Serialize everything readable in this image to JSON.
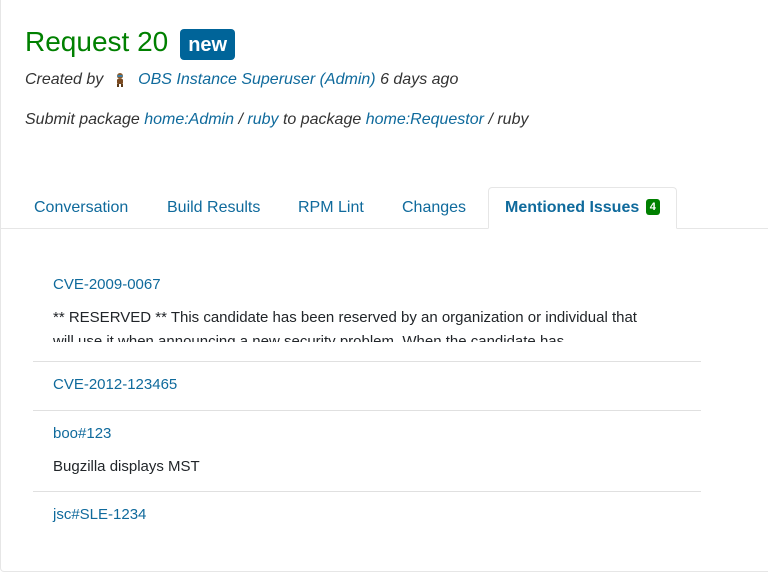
{
  "header": {
    "title": "Request 20",
    "state_badge": "new",
    "created_by_label": "Created by",
    "creator_name": "OBS Instance Superuser (Admin)",
    "created_ago": "6 days ago"
  },
  "description": {
    "action_prefix": "Submit package",
    "source_project": "home:Admin",
    "separator_1": "/",
    "source_package": "ruby",
    "middle_text": "to package",
    "target_project": "home:Requestor",
    "separator_2": "/",
    "target_package": "ruby"
  },
  "tabs": [
    {
      "label": "Conversation",
      "active": false
    },
    {
      "label": "Build Results",
      "active": false
    },
    {
      "label": "RPM Lint",
      "active": false
    },
    {
      "label": "Changes",
      "active": false
    },
    {
      "label": "Mentioned Issues",
      "active": true,
      "count": "4"
    }
  ],
  "issues": [
    {
      "id": "CVE-2009-0067",
      "summary": "** RESERVED ** This candidate has been reserved by an organization or individual that will use it when announcing a new security problem. When the candidate has"
    },
    {
      "id": "CVE-2012-123465",
      "summary": ""
    },
    {
      "id": "boo#123",
      "summary": "Bugzilla displays MST"
    },
    {
      "id": "jsc#SLE-1234",
      "summary": ""
    }
  ],
  "colors": {
    "title_green": "#008000",
    "link_blue": "#0f6a9c",
    "state_badge_bg": "#006499",
    "count_badge_bg": "#008000",
    "divider": "#e0e0e0"
  }
}
